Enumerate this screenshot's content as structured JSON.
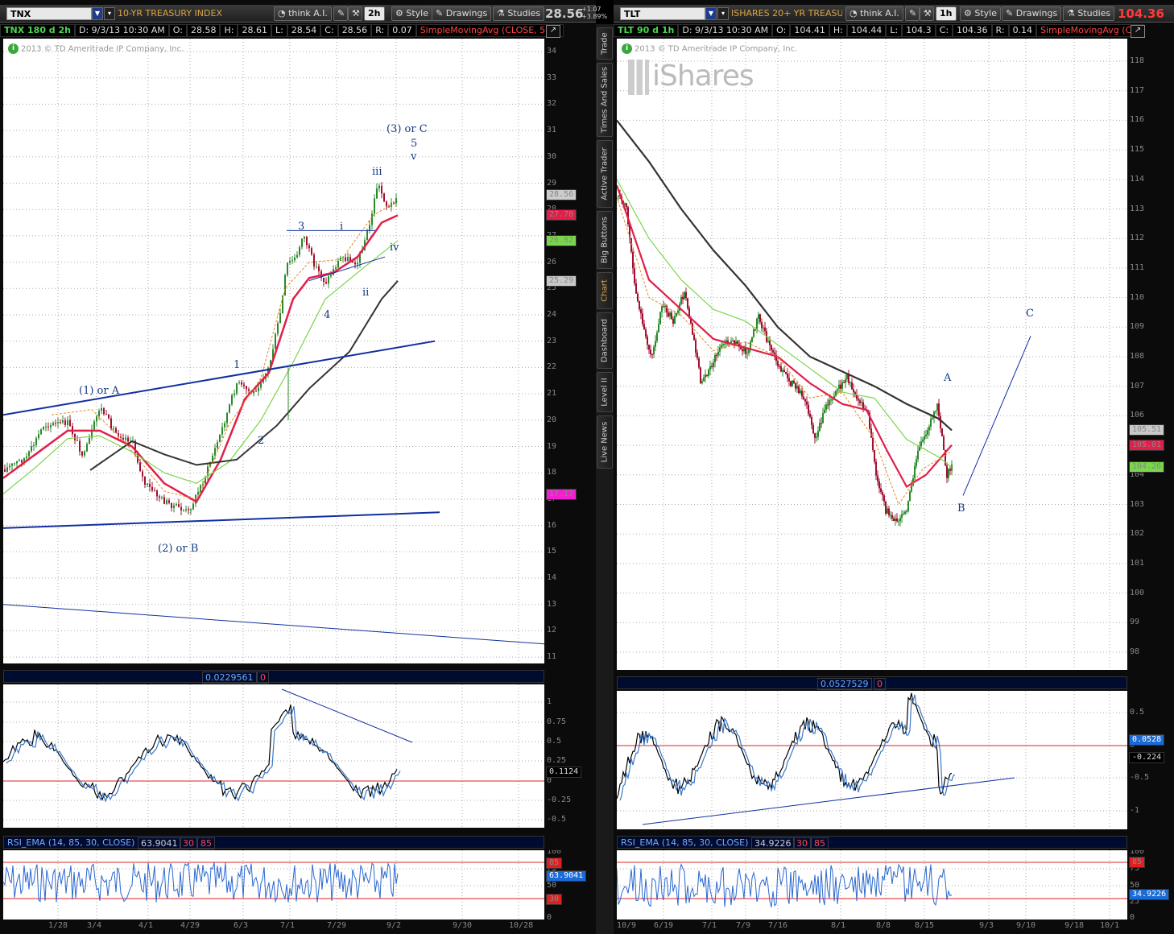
{
  "left": {
    "symbol": "TNX",
    "description": "10-YR TREASURY INDEX",
    "strategy_btn": "think A.I.",
    "aggregation": "2h",
    "style_btn": "Style",
    "drawings_btn": "Drawings",
    "studies_btn": "Studies",
    "last_price": "28.56",
    "change_abs": "+1.07",
    "change_pct": "+3.89%",
    "info": {
      "title": "TNX 180 d 2h",
      "date": "D: 9/3/13 10:30 AM",
      "open": "O:",
      "open_v": "28.58",
      "high": "H:",
      "high_v": "28.61",
      "low": "L:",
      "low_v": "28.54",
      "close": "C:",
      "close_v": "28.56",
      "range": "R:",
      "range_v": "0.07",
      "study": "SimpleMovingAvg (CLOSE, 50..."
    },
    "copyright": "2013 © TD Ameritrade IP Company, Inc.",
    "y_ticks": [
      "34",
      "33",
      "32",
      "31",
      "30",
      "29",
      "28",
      "27",
      "26",
      "25",
      "24",
      "23",
      "22",
      "21",
      "20",
      "19",
      "18",
      "17",
      "16",
      "15",
      "14",
      "13",
      "12",
      "11"
    ],
    "price_labels": [
      {
        "text": "28.56",
        "color": "#cccccc"
      },
      {
        "text": "27.78",
        "color": "#e0204a"
      },
      {
        "text": "26.82",
        "color": "#7ad64a"
      },
      {
        "text": "25.29",
        "color": "#c8c8c8"
      },
      {
        "text": "17.17",
        "color": "#f020d0"
      }
    ],
    "waves": [
      "(3) or C",
      "5",
      "v",
      "iii",
      "3",
      "i",
      "iv",
      "ii",
      "4",
      "1",
      "2",
      "(1) or A",
      "(2) or B"
    ],
    "osc": {
      "value": "0.0229561",
      "zero": "0",
      "ticks": [
        "1",
        "0.75",
        "0.5",
        "0.25",
        "0",
        "-0.25",
        "-0.5"
      ],
      "last": "0.1124"
    },
    "rsi": {
      "name": "RSI_EMA (14, 85, 30, CLOSE)",
      "value": "63.9041",
      "ob": "30",
      "os": "85",
      "ticks": [
        "100",
        "85",
        "75",
        "50",
        "30",
        "25",
        "0"
      ],
      "last_labels": [
        "85",
        "63.9041",
        "30"
      ]
    },
    "x_ticks": [
      "1/28",
      "3/4",
      "4/1",
      "4/29",
      "6/3",
      "7/1",
      "7/29",
      "9/2",
      "9/30",
      "10/28"
    ]
  },
  "right": {
    "symbol": "TLT",
    "description": "ISHARES 20+ YR TREASU...",
    "strategy_btn": "think A.I.",
    "aggregation": "1h",
    "style_btn": "Style",
    "drawings_btn": "Drawings",
    "studies_btn": "Studies",
    "last_price": "104.36",
    "info": {
      "title": "TLT 90 d 1h",
      "date": "D: 9/3/13 10:30 AM",
      "open": "O:",
      "open_v": "104.41",
      "high": "H:",
      "high_v": "104.44",
      "low": "L:",
      "low_v": "104.3",
      "close": "C:",
      "close_v": "104.36",
      "range": "R:",
      "range_v": "0.14",
      "study": "SimpleMovingAvg (C..."
    },
    "copyright": "2013 © TD Ameritrade IP Company, Inc.",
    "watermark": "iShares",
    "y_ticks": [
      "118",
      "117",
      "116",
      "115",
      "114",
      "113",
      "112",
      "111",
      "110",
      "109",
      "108",
      "107",
      "106",
      "105",
      "104",
      "103",
      "102",
      "101",
      "100",
      "99",
      "98"
    ],
    "price_labels": [
      {
        "text": "105.51",
        "color": "#c8c8c8"
      },
      {
        "text": "105.01",
        "color": "#e0204a"
      },
      {
        "text": "104.26",
        "color": "#7ad64a"
      }
    ],
    "waves": [
      "A",
      "B",
      "C"
    ],
    "osc": {
      "value": "0.0527529",
      "zero": "0",
      "ticks": [
        "0.5",
        "0",
        "-0.5",
        "-1"
      ],
      "last_labels": [
        "0.0528",
        "-0.224"
      ]
    },
    "rsi": {
      "name": "RSI_EMA (14, 85, 30, CLOSE)",
      "value": "34.9226",
      "ob": "30",
      "os": "85",
      "ticks": [
        "100",
        "85",
        "75",
        "50",
        "30",
        "25",
        "0"
      ],
      "last_labels": [
        "85",
        "34.9226"
      ]
    },
    "x_ticks": [
      "6/19",
      "7/1",
      "7/9",
      "7/16",
      "8/1",
      "8/8",
      "8/15",
      "9/3",
      "9/10",
      "9/18",
      "10/1",
      "10/9"
    ]
  },
  "sidebar": {
    "tabs": [
      "Trade",
      "Times And Sales",
      "Active Trader",
      "Big Buttons",
      "Chart",
      "Dashboard",
      "Level II",
      "Live News"
    ],
    "active": "Chart"
  },
  "colors": {
    "bg": "#0b0b0b",
    "plot": "#ffffff",
    "wave_label": "#123a82",
    "trendline": "#1030a0",
    "sma_fast": "#e0204a",
    "sma_mid": "#7ad64a",
    "sma_slow": "#333333",
    "osc_line": "#3a78c8"
  }
}
